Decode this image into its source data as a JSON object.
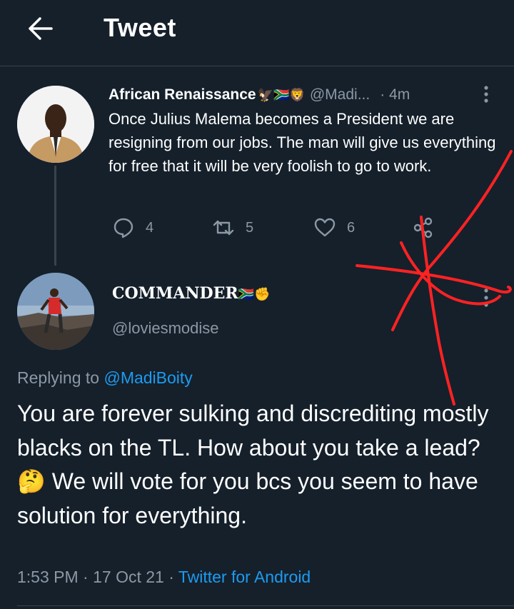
{
  "header": {
    "title": "Tweet"
  },
  "parent_tweet": {
    "name": "African Renaissance",
    "name_emojis": "🦅🇿🇦🦁",
    "handle": "@Madi...",
    "time": "· 4m",
    "text": "Once Julius Malema becomes a President we are resigning from our jobs. The man will give us everything for free that it will be very foolish to go to work.",
    "reply_count": "4",
    "retweet_count": "5",
    "like_count": "6"
  },
  "main_tweet": {
    "name": "COMMANDER",
    "name_emojis": "🇿🇦✊",
    "handle": "@loviesmodise",
    "replying_prefix": "Replying to",
    "replying_handle": "@MadiBoity",
    "text": "You are forever sulking and discrediting mostly blacks on the TL. How about you take a lead? 🤔 We will vote for you bcs you seem to have solution for everything.",
    "time": "1:53 PM · 17 Oct 21 · ",
    "source": "Twitter for Android"
  },
  "colors": {
    "background": "#15202b",
    "divider": "#38444d",
    "secondary_text": "#8b98a5",
    "link": "#1d9bf0",
    "annotation_red": "#ff2222"
  },
  "icons": [
    "back-arrow-icon",
    "more-vertical-icon",
    "reply-icon",
    "retweet-icon",
    "like-icon",
    "share-icon"
  ]
}
